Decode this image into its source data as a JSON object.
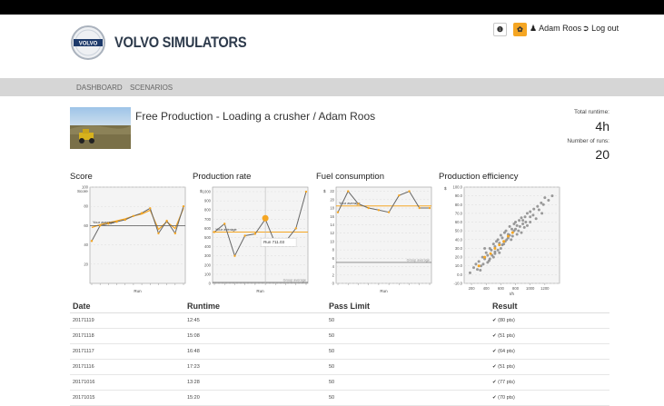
{
  "brand": {
    "logo_text": "VOLVO",
    "name": "VOLVO SIMULATORS"
  },
  "header": {
    "info_icon_label": "❶",
    "settings_icon_label": "✿",
    "user_name": "Adam Roos",
    "logout_label": "Log out"
  },
  "nav": {
    "items": [
      {
        "label": "DASHBOARD"
      },
      {
        "label": "SCENARIOS"
      }
    ]
  },
  "scenario": {
    "title": "Free Production - Loading a crusher / Adam Roos"
  },
  "stats": {
    "runtime_label": "Total runtime:",
    "runtime_value": "4h",
    "runs_label": "Number of runs:",
    "runs_value": "20"
  },
  "chart_data": [
    {
      "type": "line",
      "title": "Score",
      "ylabel": "Score",
      "xlabel": "Run",
      "ylim": [
        0,
        100
      ],
      "yticks": [
        "100",
        "80",
        "60",
        "40",
        "20"
      ],
      "series": [
        {
          "values": [
            44,
            60,
            62,
            64,
            66,
            70,
            73,
            78,
            52,
            65,
            52,
            80
          ]
        }
      ],
      "average": [
        58,
        61,
        63,
        65,
        67,
        70,
        72,
        76,
        56,
        64,
        57,
        78
      ],
      "average_label": "Your average",
      "group_average": 60
    },
    {
      "type": "line",
      "title": "Production rate",
      "ylabel": "$",
      "xlabel": "Run",
      "ylim": [
        0,
        1050
      ],
      "yticks": [
        "1000",
        "900",
        "800",
        "700",
        "600",
        "500",
        "400",
        "300",
        "200",
        "100",
        "0"
      ],
      "series": [
        {
          "values": [
            560,
            650,
            300,
            520,
            540,
            700,
            430,
            460,
            600,
            1000
          ]
        }
      ],
      "average_label": "Your average",
      "average": 560,
      "group_average_label": "Group average",
      "group_average": 10,
      "tooltip": "Run 711.03",
      "highlight_value": 711
    },
    {
      "type": "line",
      "title": "Fuel consumption",
      "ylabel": "$",
      "xlabel": "Run",
      "ylim": [
        0,
        23
      ],
      "yticks": [
        "22",
        "20",
        "18",
        "16",
        "14",
        "12",
        "10",
        "8",
        "6",
        "4",
        "2",
        "0"
      ],
      "series": [
        {
          "values": [
            17,
            22,
            19,
            18,
            17.5,
            17,
            21,
            22,
            18,
            18
          ]
        }
      ],
      "average_label": "Your average",
      "average": 18.5,
      "group_average_label": "Group average",
      "group_average": 5
    },
    {
      "type": "scatter",
      "title": "Production efficiency",
      "ylabel": "$",
      "xlabel": "t/h",
      "xlim": [
        100,
        1400
      ],
      "ylim": [
        -10,
        100
      ],
      "xticks": [
        "200",
        "400",
        "600",
        "800",
        "1000",
        "1200"
      ],
      "yticks": [
        "100.0",
        "90.0",
        "80.0",
        "70.0",
        "60.0",
        "50.0",
        "40.0",
        "30.0",
        "20.0",
        "10.0",
        "0.0",
        "-10.0"
      ],
      "points": [
        [
          180,
          2
        ],
        [
          230,
          8
        ],
        [
          260,
          12
        ],
        [
          300,
          15
        ],
        [
          330,
          10
        ],
        [
          350,
          20
        ],
        [
          380,
          18
        ],
        [
          400,
          25
        ],
        [
          420,
          22
        ],
        [
          450,
          30
        ],
        [
          470,
          28
        ],
        [
          500,
          35
        ],
        [
          520,
          32
        ],
        [
          540,
          38
        ],
        [
          560,
          40
        ],
        [
          580,
          36
        ],
        [
          600,
          45
        ],
        [
          620,
          42
        ],
        [
          650,
          48
        ],
        [
          670,
          50
        ],
        [
          700,
          46
        ],
        [
          720,
          55
        ],
        [
          750,
          52
        ],
        [
          780,
          58
        ],
        [
          800,
          60
        ],
        [
          820,
          56
        ],
        [
          850,
          62
        ],
        [
          880,
          65
        ],
        [
          900,
          58
        ],
        [
          930,
          66
        ],
        [
          960,
          70
        ],
        [
          1000,
          72
        ],
        [
          1050,
          75
        ],
        [
          1100,
          78
        ],
        [
          1150,
          82
        ],
        [
          1200,
          88
        ],
        [
          1250,
          85
        ],
        [
          1300,
          90
        ],
        [
          380,
          30
        ],
        [
          450,
          18
        ],
        [
          520,
          26
        ],
        [
          600,
          30
        ],
        [
          680,
          40
        ],
        [
          760,
          44
        ],
        [
          840,
          50
        ],
        [
          920,
          54
        ],
        [
          1000,
          60
        ],
        [
          1080,
          64
        ],
        [
          1160,
          70
        ],
        [
          320,
          5
        ],
        [
          480,
          22
        ],
        [
          560,
          28
        ],
        [
          640,
          35
        ],
        [
          720,
          45
        ],
        [
          800,
          52
        ],
        [
          880,
          48
        ],
        [
          960,
          56
        ],
        [
          1040,
          68
        ],
        [
          420,
          14
        ],
        [
          500,
          20
        ],
        [
          580,
          25
        ],
        [
          660,
          38
        ],
        [
          740,
          40
        ],
        [
          820,
          46
        ],
        [
          900,
          62
        ],
        [
          1000,
          66
        ],
        [
          280,
          6
        ],
        [
          360,
          12
        ],
        [
          440,
          16
        ],
        [
          520,
          24
        ],
        [
          620,
          34
        ],
        [
          700,
          42
        ],
        [
          780,
          50
        ],
        [
          860,
          55
        ],
        [
          940,
          60
        ],
        [
          1120,
          74
        ],
        [
          1180,
          80
        ]
      ],
      "highlight_points": [
        [
          300,
          10
        ],
        [
          380,
          20
        ],
        [
          460,
          24
        ],
        [
          520,
          30
        ],
        [
          580,
          34
        ],
        [
          640,
          38
        ],
        [
          700,
          44
        ],
        [
          760,
          48
        ]
      ]
    }
  ],
  "table": {
    "headers": [
      "Date",
      "Runtime",
      "Pass Limit",
      "Result"
    ],
    "rows": [
      {
        "date": "20171119",
        "runtime": "12:45",
        "limit": "50",
        "result": "✔ (80 pts)"
      },
      {
        "date": "20171118",
        "runtime": "15:08",
        "limit": "50",
        "result": "✔ (51 pts)"
      },
      {
        "date": "20171117",
        "runtime": "16:48",
        "limit": "50",
        "result": "✔ (64 pts)"
      },
      {
        "date": "20171116",
        "runtime": "17:23",
        "limit": "50",
        "result": "✔ (51 pts)"
      },
      {
        "date": "20171016",
        "runtime": "13:28",
        "limit": "50",
        "result": "✔ (77 pts)"
      },
      {
        "date": "20171015",
        "runtime": "15:20",
        "limit": "50",
        "result": "✔ (70 pts)"
      }
    ]
  },
  "colors": {
    "accent": "#f5a623",
    "line": "#666666",
    "topbar": "#000000",
    "nav": "#d6d6d6",
    "success": "#2a8a2a"
  }
}
